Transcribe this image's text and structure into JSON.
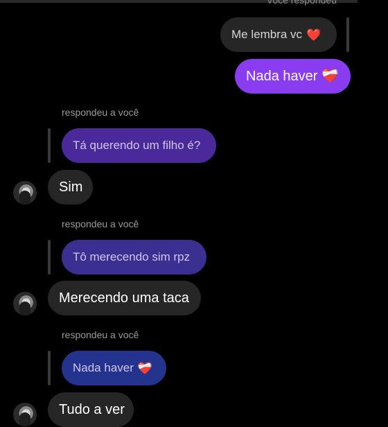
{
  "top_label": "Você respondeu",
  "messages": {
    "quoted_1": {
      "text": "Me lembra vc",
      "emoji": "❤️"
    },
    "mine_1": {
      "text": "Nada haver",
      "emoji": "❤️‍🩹"
    },
    "reply_note_1": "respondeu a você",
    "quoted_2": {
      "text": "Tá querendo um filho é?"
    },
    "theirs_1": {
      "text": "Sim"
    },
    "reply_note_2": "respondeu a você",
    "quoted_3": {
      "text": "Tô merecendo sim rpz"
    },
    "theirs_2": {
      "text": "Merecendo uma taca"
    },
    "reply_note_3": "respondeu a você",
    "quoted_4": {
      "text": "Nada haver",
      "emoji": "❤️‍🩹"
    },
    "theirs_3": {
      "text": "Tudo a ver"
    }
  },
  "colors": {
    "background": "#000000",
    "sent_bubble": "#8A3CF0",
    "received_bubble": "#262626",
    "quoted_sent_1": "#4A2A9A",
    "quoted_sent_2": "#3B2F92",
    "quoted_sent_3": "#24338D"
  }
}
